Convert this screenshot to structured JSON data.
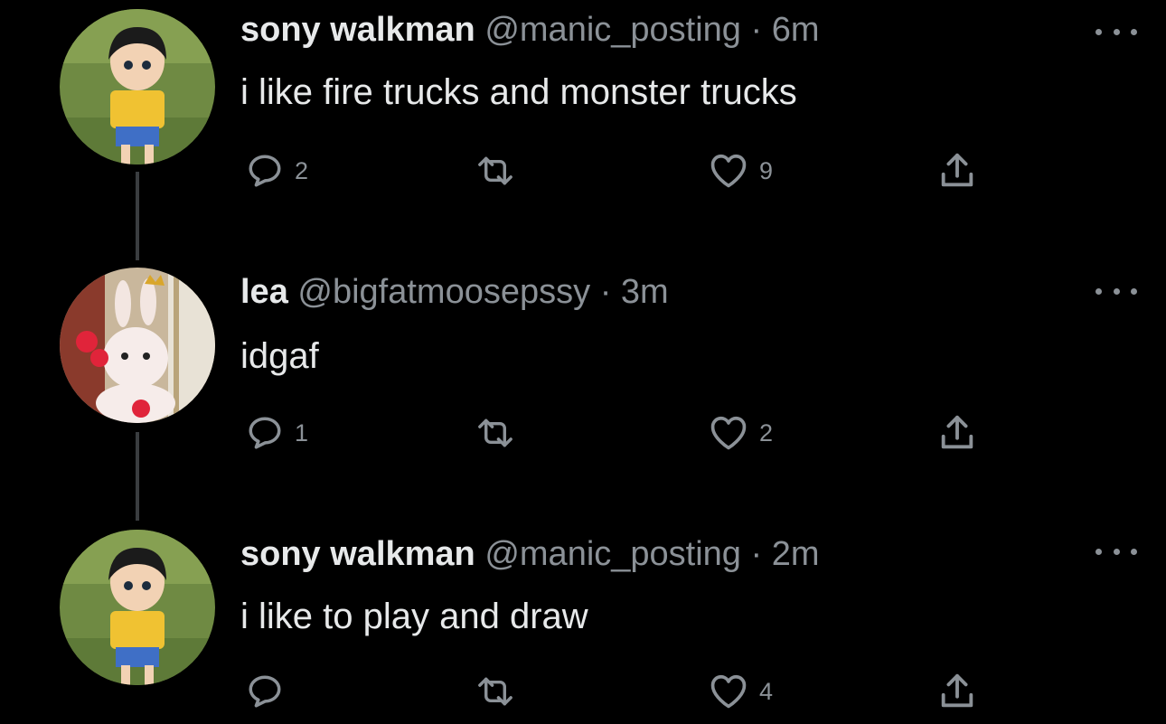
{
  "colors": {
    "background": "#000000",
    "text_primary": "#e7e9ea",
    "text_secondary": "#8b9197",
    "thread_line": "#3a3d40"
  },
  "tweets": [
    {
      "name": "sony walkman",
      "handle": "@manic_posting",
      "separator": "·",
      "time": "6m",
      "text": "i like fire trucks and monster trucks",
      "avatar_icon": "anime-boy-avatar-icon",
      "counts": {
        "reply": "2",
        "retweet": "",
        "like": "9"
      }
    },
    {
      "name": "lea",
      "handle": "@bigfatmoosepssy",
      "separator": "·",
      "time": "3m",
      "text": "idgaf",
      "avatar_icon": "bunny-plush-avatar-icon",
      "counts": {
        "reply": "1",
        "retweet": "",
        "like": "2"
      }
    },
    {
      "name": "sony walkman",
      "handle": "@manic_posting",
      "separator": "·",
      "time": "2m",
      "text": "i like to play and draw",
      "avatar_icon": "anime-boy-avatar-icon",
      "counts": {
        "reply": "",
        "retweet": "",
        "like": "4"
      }
    }
  ],
  "icons": {
    "reply": "speech-bubble-icon",
    "retweet": "retweet-arrows-icon",
    "like": "heart-icon",
    "share": "share-upload-icon",
    "more": "more-dots-icon"
  }
}
